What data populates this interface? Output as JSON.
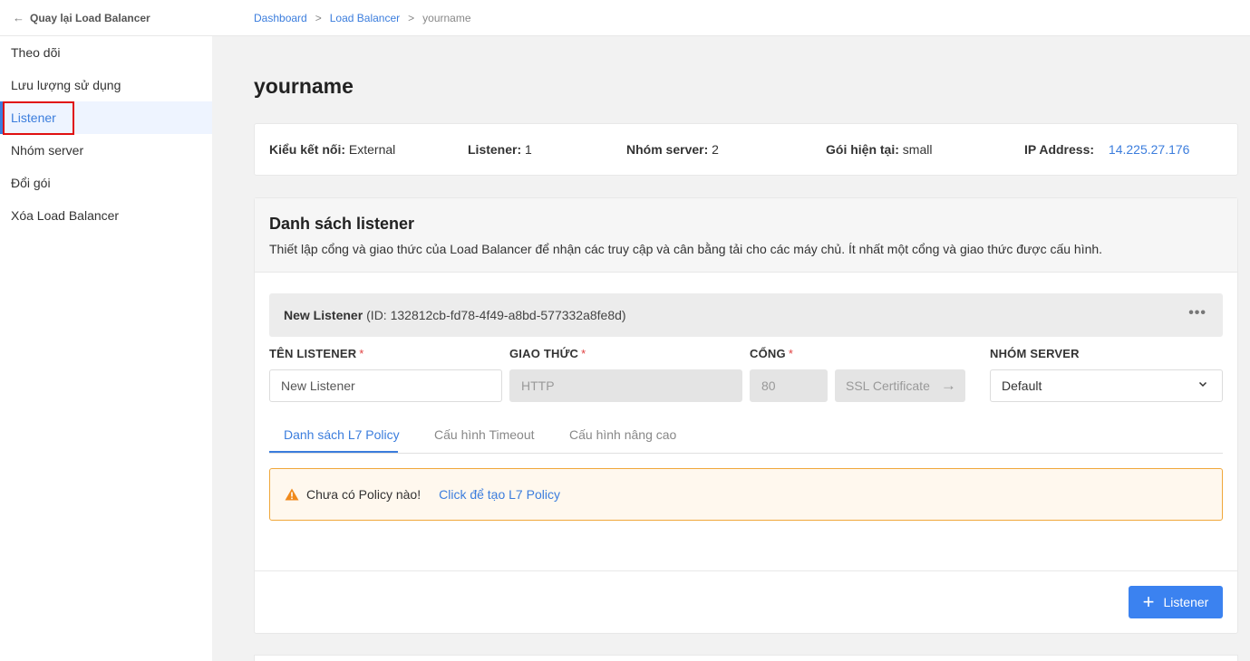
{
  "sidebar": {
    "back_label": "Quay lại Load Balancer",
    "items": [
      {
        "label": "Theo dõi"
      },
      {
        "label": "Lưu lượng sử dụng"
      },
      {
        "label": "Listener"
      },
      {
        "label": "Nhóm server"
      },
      {
        "label": "Đổi gói"
      },
      {
        "label": "Xóa Load Balancer"
      }
    ]
  },
  "breadcrumb": {
    "items": [
      "Dashboard",
      "Load Balancer",
      "yourname"
    ],
    "separator": ">"
  },
  "page": {
    "title": "yourname"
  },
  "info": {
    "connection_type_label": "Kiểu kết nối:",
    "connection_type_value": "External",
    "listener_label": "Listener:",
    "listener_value": "1",
    "server_group_label": "Nhóm server:",
    "server_group_value": "2",
    "plan_label": "Gói hiện tại:",
    "plan_value": "small",
    "ip_label": "IP Address:",
    "ip_value": "14.225.27.176"
  },
  "listeners": {
    "title": "Danh sách listener",
    "description": "Thiết lập cổng và giao thức của Load Balancer để nhận các truy cập và cân bằng tải cho các máy chủ. Ít nhất một cổng và giao thức được cấu hình.",
    "item": {
      "name": "New Listener",
      "id_text": "(ID: 132812cb-fd78-4f49-a8bd-577332a8fe8d)",
      "more": "•••"
    },
    "fields": {
      "name_label": "TÊN LISTENER",
      "name_value": "New Listener",
      "protocol_label": "GIAO THỨC",
      "protocol_value": "HTTP",
      "port_label": "CỔNG",
      "port_value": "80",
      "ssl_label": "SSL Certificate",
      "server_group_label": "NHÓM SERVER",
      "server_group_value": "Default",
      "required_mark": "*"
    },
    "tabs": [
      "Danh sách L7 Policy",
      "Cấu hình Timeout",
      "Cấu hình nâng cao"
    ],
    "alert": {
      "message": "Chưa có Policy nào!",
      "link": "Click để tạo L7 Policy"
    },
    "add_button": "Listener"
  },
  "colors": {
    "accent": "#3b7ddd",
    "button": "#3b82f0",
    "warning_border": "#f0a73a",
    "warning_bg": "#fff8ee",
    "highlight": "#e01010"
  }
}
